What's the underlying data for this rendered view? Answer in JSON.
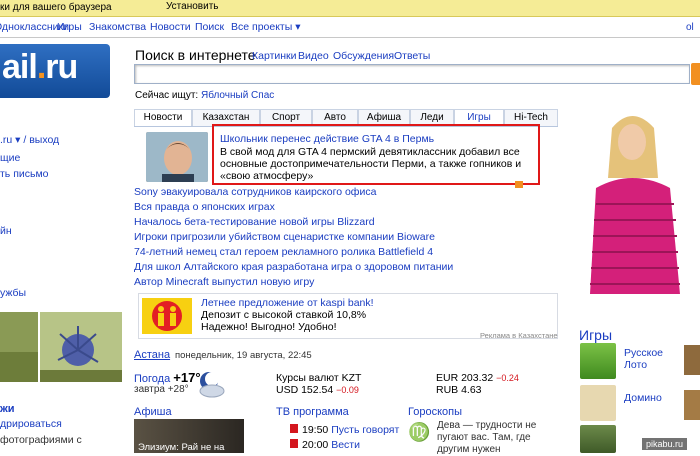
{
  "promo": {
    "text": "ки для вашего браузера",
    "button": "Установить"
  },
  "topnav": {
    "items": [
      "...",
      "Одноклассники",
      "Игры",
      "Знакомства",
      "Новости",
      "Поиск",
      "Все проекты ▾"
    ],
    "right": "ol"
  },
  "logo": {
    "main": "ail",
    "dot": ".",
    "tld": "ru"
  },
  "search": {
    "title": "Поиск в интернете",
    "tabs": [
      "Картинки",
      "Видео",
      "Обсуждения",
      "Ответы"
    ],
    "input_value": "",
    "now_label": "Сейчас ищут:",
    "now_value": "Яблочный Спас"
  },
  "left": {
    "login": ".ru ▾ / выход",
    "l2": "щие",
    "l3": "ть письмо",
    "l4": "йн",
    "l5": "ужбы",
    "l6": "жи",
    "l7": "дрироваться",
    "l8": "фотографиями с"
  },
  "news": {
    "tabs": [
      "Новости",
      "Казахстан",
      "Спорт",
      "Авто",
      "Афиша",
      "Леди",
      "Игры",
      "Hi-Tech"
    ],
    "headline_title": "Школьник перенес действие GTA 4 в Пермь",
    "headline_text": "В свой мод для GTA 4 пермский девятиклассник добавил все основные достопримечательности Перми, а также гопников и «свою атмосферу»",
    "items": [
      "Sony эвакуировала сотрудников каирского офиса",
      "Вся правда о японских играх",
      "Началось бета-тестирование новой игры Blizzard",
      "Игроки пригрозили убийством сценаристке компании Bioware",
      "74-летний немец стал героем рекламного ролика Battlefield 4",
      "Для школ Алтайского края разработана игра о здоровом питании",
      "Автор Minecraft выпустил новую игру"
    ]
  },
  "ad": {
    "line1": "Летнее предложение от kaspi bank!",
    "line2": "Депозит с высокой ставкой 10,8%",
    "line3": "Надежно! Выгодно! Удобно!",
    "footer": "Реклама в Казахстане"
  },
  "info": {
    "city": "Астана",
    "date": "понедельник, 19 августа, 22:45",
    "weather_label": "Погода",
    "weather_temp": "+17°",
    "weather_tomorrow": "завтра +28°",
    "currency_title": "Курсы валют KZT",
    "usd": "USD 152.54",
    "usd_change": "−0.09",
    "eur": "EUR 203.32",
    "eur_change": "−0.24",
    "rub": "RUB 4.63"
  },
  "sections": {
    "afisha": "Афиша",
    "afisha_caption": "Элизиум: Рай не на",
    "tv": "ТВ программа",
    "tv1_time": "19:50",
    "tv1_title": "Пусть говорят",
    "tv2_time": "20:00",
    "tv2_title": "Вести",
    "horo": "Гороскопы",
    "horo_sign": "♍",
    "horo_text": "Дева — трудности не пугают вас. Там, где другим нужен"
  },
  "games": {
    "title": "Игры",
    "g1": "Русское Лото",
    "g2": "Домино"
  },
  "watermark": "pikabu.ru",
  "colors": {
    "link": "#1a3dc1",
    "highlight_border": "#e01818",
    "accent": "#f29021"
  }
}
